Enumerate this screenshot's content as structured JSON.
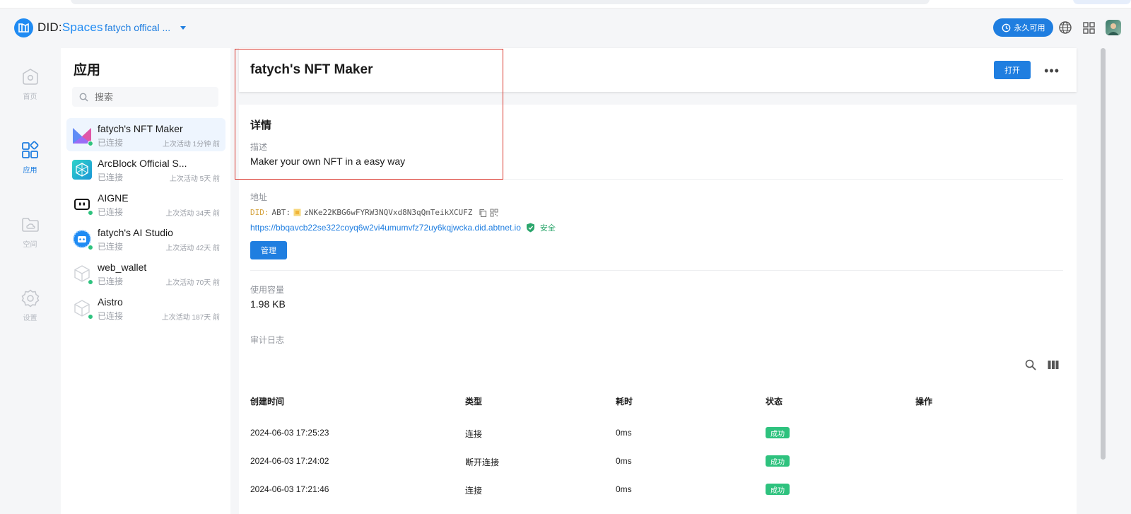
{
  "header": {
    "logo_text_prefix": "DID:",
    "logo_text_suffix": "Spaces",
    "space_name": "fatych offical ...",
    "permanent_label": "永久可用"
  },
  "rail": {
    "items": [
      {
        "label": "首页"
      },
      {
        "label": "应用"
      },
      {
        "label": "空间"
      },
      {
        "label": "设置"
      }
    ]
  },
  "apps_panel": {
    "title": "应用",
    "search_placeholder": "搜索",
    "items": [
      {
        "name": "fatych's NFT Maker",
        "status": "已连接",
        "last_active": "上次活动 1分钟 前"
      },
      {
        "name": "ArcBlock Official S...",
        "status": "已连接",
        "last_active": "上次活动 5天 前"
      },
      {
        "name": "AIGNE",
        "status": "已连接",
        "last_active": "上次活动 34天 前"
      },
      {
        "name": "fatych's AI Studio",
        "status": "已连接",
        "last_active": "上次活动 42天 前"
      },
      {
        "name": "web_wallet",
        "status": "已连接",
        "last_active": "上次活动 70天 前"
      },
      {
        "name": "Aistro",
        "status": "已连接",
        "last_active": "上次活动 187天 前"
      }
    ]
  },
  "main": {
    "title": "fatych's NFT Maker",
    "open_label": "打开",
    "more_label": "•••",
    "details_title": "详情",
    "description_label": "描述",
    "description_value": "Maker your own NFT in a easy way",
    "address_label": "地址",
    "did_prefix": "DID:",
    "did_abt": "ABT:",
    "did_value": "zNKe22KBG6wFYRW3NQVxd8N3qQmTeikXCUFZ",
    "url": "https://bbqavcb22se322coyq6w2vi4umumvfz72uy6kqjwcka.did.abtnet.io",
    "safe_label": "安全",
    "manage_label": "管理",
    "usage_label": "使用容量",
    "usage_value": "1.98 KB",
    "audit_label": "审计日志",
    "audit_table": {
      "columns": [
        "创建时间",
        "类型",
        "耗时",
        "状态",
        "操作"
      ],
      "rows": [
        {
          "time": "2024-06-03 17:25:23",
          "type": "连接",
          "duration": "0ms",
          "status": "成功"
        },
        {
          "time": "2024-06-03 17:24:02",
          "type": "断开连接",
          "duration": "0ms",
          "status": "成功"
        },
        {
          "time": "2024-06-03 17:21:46",
          "type": "连接",
          "duration": "0ms",
          "status": "成功"
        }
      ]
    }
  },
  "colors": {
    "accent": "#1f7ee0",
    "success": "#2ec27e",
    "highlight": "#d9342b"
  }
}
